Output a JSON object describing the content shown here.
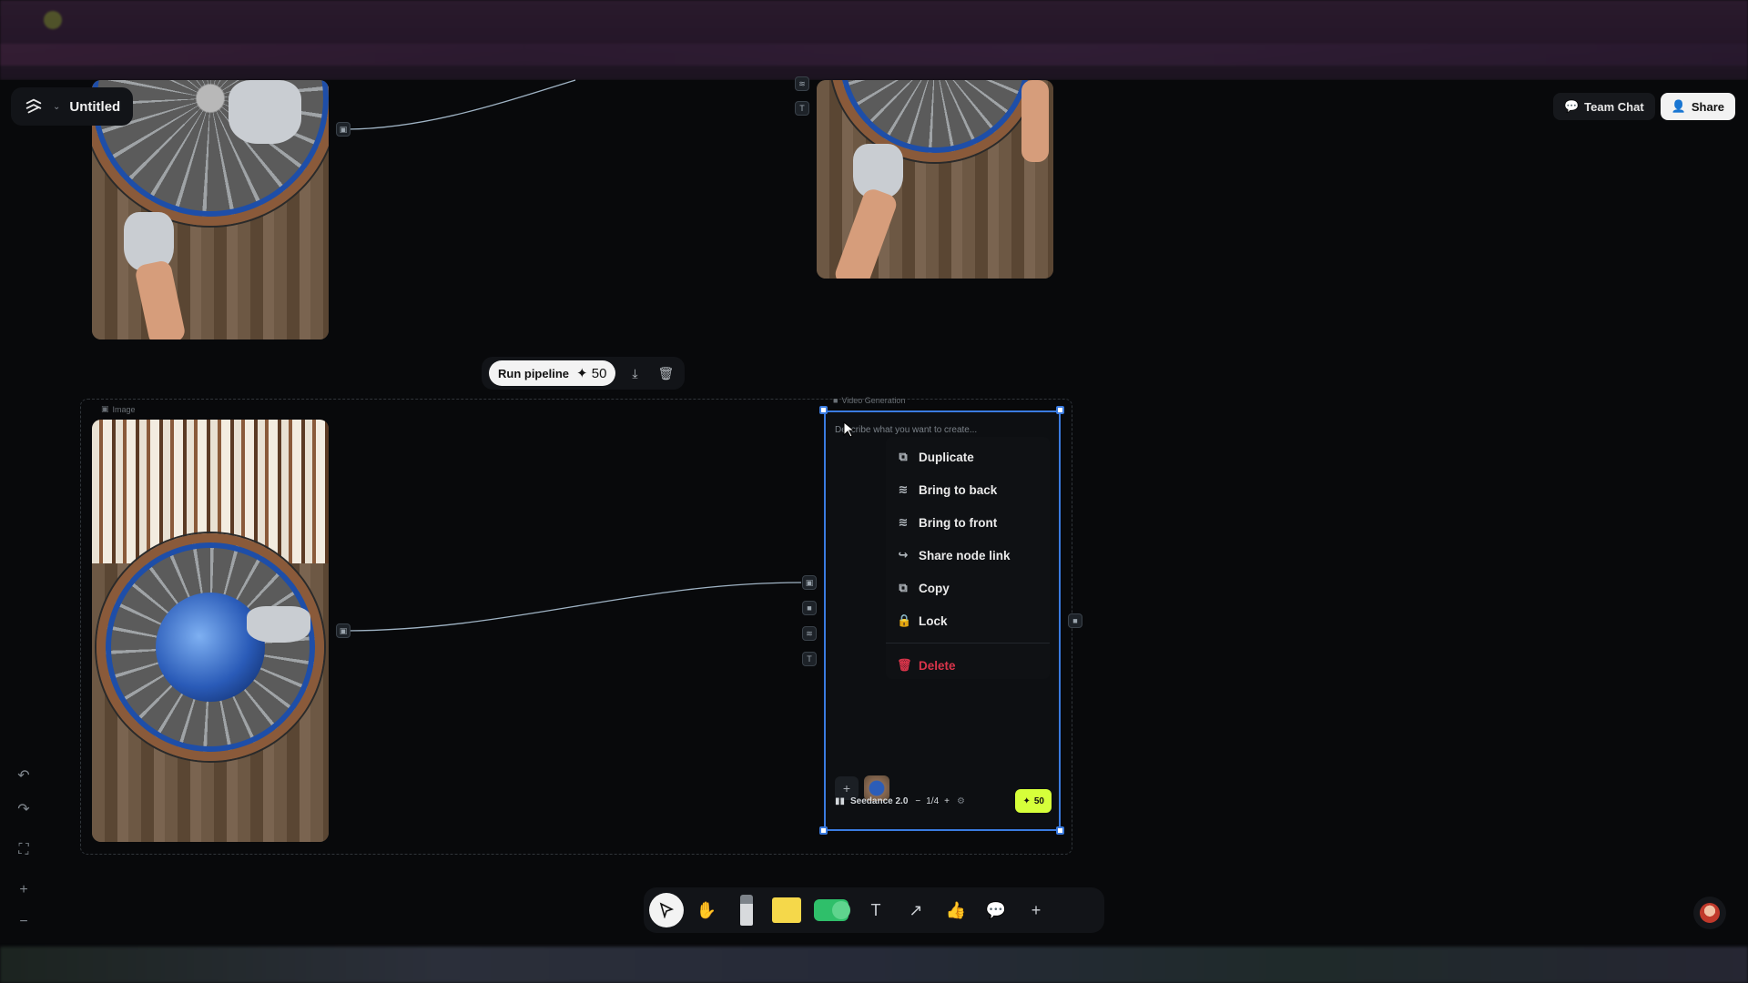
{
  "app": {
    "title": "Untitled"
  },
  "topbar": {
    "team_chat_label": "Team Chat",
    "share_label": "Share"
  },
  "pipeline": {
    "run_label": "Run pipeline",
    "cost": "50"
  },
  "group": {
    "label": "Image"
  },
  "video_node": {
    "label": "Video Generation",
    "prompt_placeholder": "Describe what you want to create...",
    "model": "Seedance 2.0",
    "count": "1/4",
    "generate_cost": "50"
  },
  "context_menu": {
    "items": [
      {
        "label": "Duplicate",
        "icon": "duplicate-icon"
      },
      {
        "label": "Bring to back",
        "icon": "layers-back-icon"
      },
      {
        "label": "Bring to front",
        "icon": "layers-front-icon"
      },
      {
        "label": "Share node link",
        "icon": "share-icon"
      },
      {
        "label": "Copy",
        "icon": "copy-icon"
      },
      {
        "label": "Lock",
        "icon": "lock-icon"
      }
    ],
    "delete_label": "Delete"
  },
  "colors": {
    "accent": "#3a7be0",
    "generate": "#d6ff3a",
    "danger": "#d9344a"
  }
}
